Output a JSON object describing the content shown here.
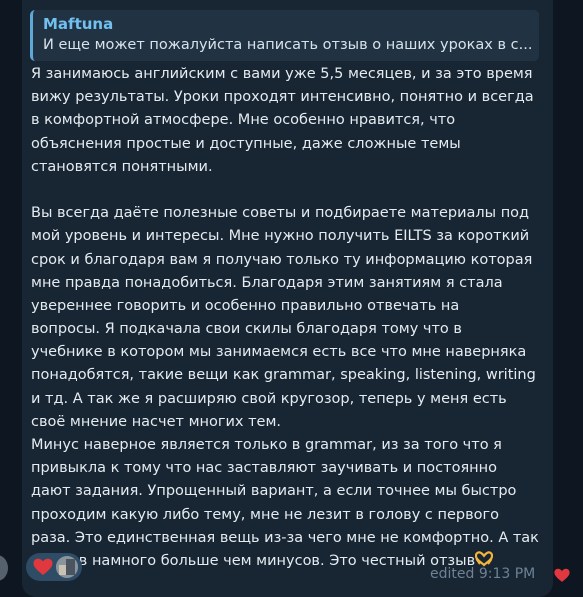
{
  "reply": {
    "author": "Maftuna",
    "text": "И еще может пожалуйста написать отзыв о наших уроках в с..."
  },
  "message": {
    "lines": [
      "Я занимаюсь английским с вами уже 5,5 месяцев, и за это время",
      "вижу результаты. Уроки проходят интенсивно, понятно и всегда",
      "в комфортной атмосфере. Мне особенно нравится, что",
      "объяснения простые и доступные, даже сложные темы",
      "становятся понятными.",
      "",
      "Вы всегда даёте полезные советы и подбираете материалы под",
      "мой уровень и интересы. Мне нужно получить EILTS за короткий",
      "срок и благодаря вам я получаю только ту информацию которая",
      "мне правда понадобиться. Благодаря этим занятиям я стала",
      "увереннее говорить и особенно правильно отвечать на",
      "вопросы. Я подкачала свои скилы благодаря  тому что в",
      "учебнике в котором мы занимаемся есть все что мне наверняка",
      "понадобятся, такие вещи как grammar, speaking, listening, writing",
      "и тд. А так же я расширяю свой кругозор, теперь у меня есть",
      "своё мнение насчет многих тем.",
      "Минус наверное является только в grammar, из за того что я",
      "привыкла к тому что нас заставляют заучивать и постоянно",
      "дают задания. Упрощенный вариант, а если точнее мы быстро",
      "проходим какую либо тему, мне не лезит в голову с первого",
      "раза. Это единственная вещь из-за чего мне не комфортно. А так",
      "плюсов намного больше чем минусов. Это честный отзыв"
    ],
    "trailing_emoji": "heart-hands-emoji"
  },
  "footer": {
    "edited_time": "edited 9:13 PM"
  },
  "reactions": {
    "emoji": "red-heart",
    "count_shown_as": "avatar"
  },
  "colors": {
    "app_background": "#0e1621",
    "bubble": "#182533",
    "reply_background": "#213343",
    "reply_accent": "#5fa8d8",
    "author_name": "#71c0f0",
    "text": "#e4ebf1",
    "meta": "#6d8294",
    "reaction_pill": "#2e4c66",
    "heart": "#e0383e"
  }
}
